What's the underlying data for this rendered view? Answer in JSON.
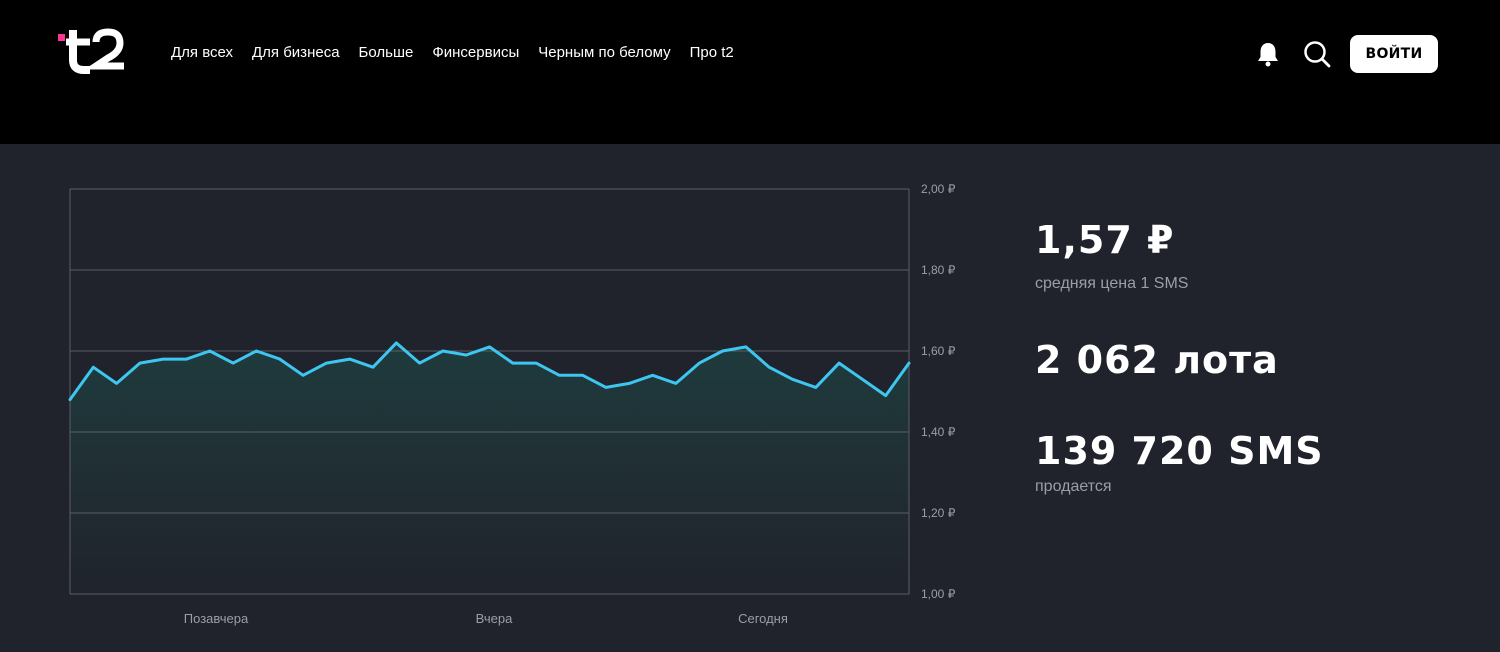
{
  "header": {
    "logo_text": "t2",
    "nav": [
      "Для всех",
      "Для бизнеса",
      "Больше",
      "Финсервисы",
      "Черным по белому",
      "Про t2"
    ],
    "login_label": "ВОЙТИ",
    "icons": [
      "bell-icon",
      "search-icon"
    ],
    "accent_color": "#ff3495"
  },
  "stats": {
    "price": "1,57 ₽",
    "price_caption": "средняя цена 1 SMS",
    "lots": "2 062 лота",
    "sms": "139 720 SMS",
    "sms_caption": "продается"
  },
  "chart_data": {
    "type": "area",
    "x_tick_labels": [
      "Позавчера",
      "Вчера",
      "Сегодня"
    ],
    "y_tick_labels": [
      "2,00 ₽",
      "1,80 ₽",
      "1,60 ₽",
      "1,40 ₽",
      "1,20 ₽",
      "1,00 ₽"
    ],
    "ylim": [
      1.0,
      2.0
    ],
    "grid": true,
    "line_color": "#3ec6f0",
    "values": [
      1.48,
      1.56,
      1.52,
      1.57,
      1.58,
      1.58,
      1.6,
      1.57,
      1.6,
      1.58,
      1.54,
      1.57,
      1.58,
      1.56,
      1.62,
      1.57,
      1.6,
      1.59,
      1.61,
      1.57,
      1.57,
      1.54,
      1.54,
      1.51,
      1.52,
      1.54,
      1.52,
      1.57,
      1.6,
      1.61,
      1.56,
      1.53,
      1.51,
      1.57,
      1.53,
      1.49,
      1.57
    ]
  }
}
